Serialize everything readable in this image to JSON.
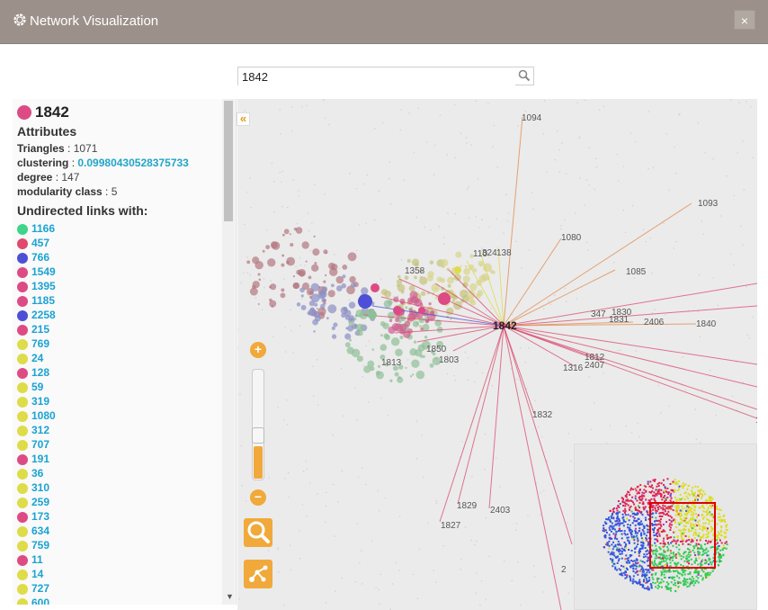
{
  "window": {
    "title": "Network Visualization",
    "close_label": "×"
  },
  "search": {
    "value": "1842",
    "placeholder": ""
  },
  "node": {
    "id": "1842",
    "color": "#dd4b85",
    "attributes_heading": "Attributes",
    "attributes": [
      {
        "key": "Triangles",
        "value": "1071"
      },
      {
        "key": "clustering",
        "value": "0.09980430528375733"
      },
      {
        "key": "degree",
        "value": "147"
      },
      {
        "key": "modularity class",
        "value": "5"
      }
    ],
    "links_heading": "Undirected links with:",
    "links": [
      {
        "id": "1166",
        "color": "#3ed48a"
      },
      {
        "id": "457",
        "color": "#e0486e"
      },
      {
        "id": "766",
        "color": "#4d4fd6"
      },
      {
        "id": "1549",
        "color": "#dd4b85"
      },
      {
        "id": "1395",
        "color": "#dd4b85"
      },
      {
        "id": "1185",
        "color": "#dd4b85"
      },
      {
        "id": "2258",
        "color": "#4d4fd6"
      },
      {
        "id": "215",
        "color": "#dd4b85"
      },
      {
        "id": "769",
        "color": "#dedc48"
      },
      {
        "id": "24",
        "color": "#dedc48"
      },
      {
        "id": "128",
        "color": "#dd4b85"
      },
      {
        "id": "59",
        "color": "#dedc48"
      },
      {
        "id": "319",
        "color": "#dedc48"
      },
      {
        "id": "1080",
        "color": "#dedc48"
      },
      {
        "id": "312",
        "color": "#dedc48"
      },
      {
        "id": "707",
        "color": "#dedc48"
      },
      {
        "id": "191",
        "color": "#dd4b85"
      },
      {
        "id": "36",
        "color": "#dedc48"
      },
      {
        "id": "310",
        "color": "#dedc48"
      },
      {
        "id": "259",
        "color": "#dedc48"
      },
      {
        "id": "173",
        "color": "#dd4b85"
      },
      {
        "id": "634",
        "color": "#dedc48"
      },
      {
        "id": "759",
        "color": "#dedc48"
      },
      {
        "id": "11",
        "color": "#dd4b85"
      },
      {
        "id": "14",
        "color": "#dedc48"
      },
      {
        "id": "727",
        "color": "#dedc48"
      },
      {
        "id": "600",
        "color": "#dedc48"
      }
    ]
  },
  "graph": {
    "center_label": "1842",
    "labels": [
      "1094",
      "1093",
      "1080",
      "1085",
      "1358",
      "324",
      "138",
      "110",
      "347",
      "1830",
      "1831",
      "2406",
      "1840",
      "1812",
      "2407",
      "1316",
      "1832",
      "1829",
      "2403",
      "1827",
      "1813",
      "1803",
      "1850",
      "18",
      "2"
    ]
  },
  "controls": {
    "collapse_label": "«",
    "zoom_in_label": "+",
    "zoom_out_label": "−",
    "zoom_level": 0.3
  }
}
